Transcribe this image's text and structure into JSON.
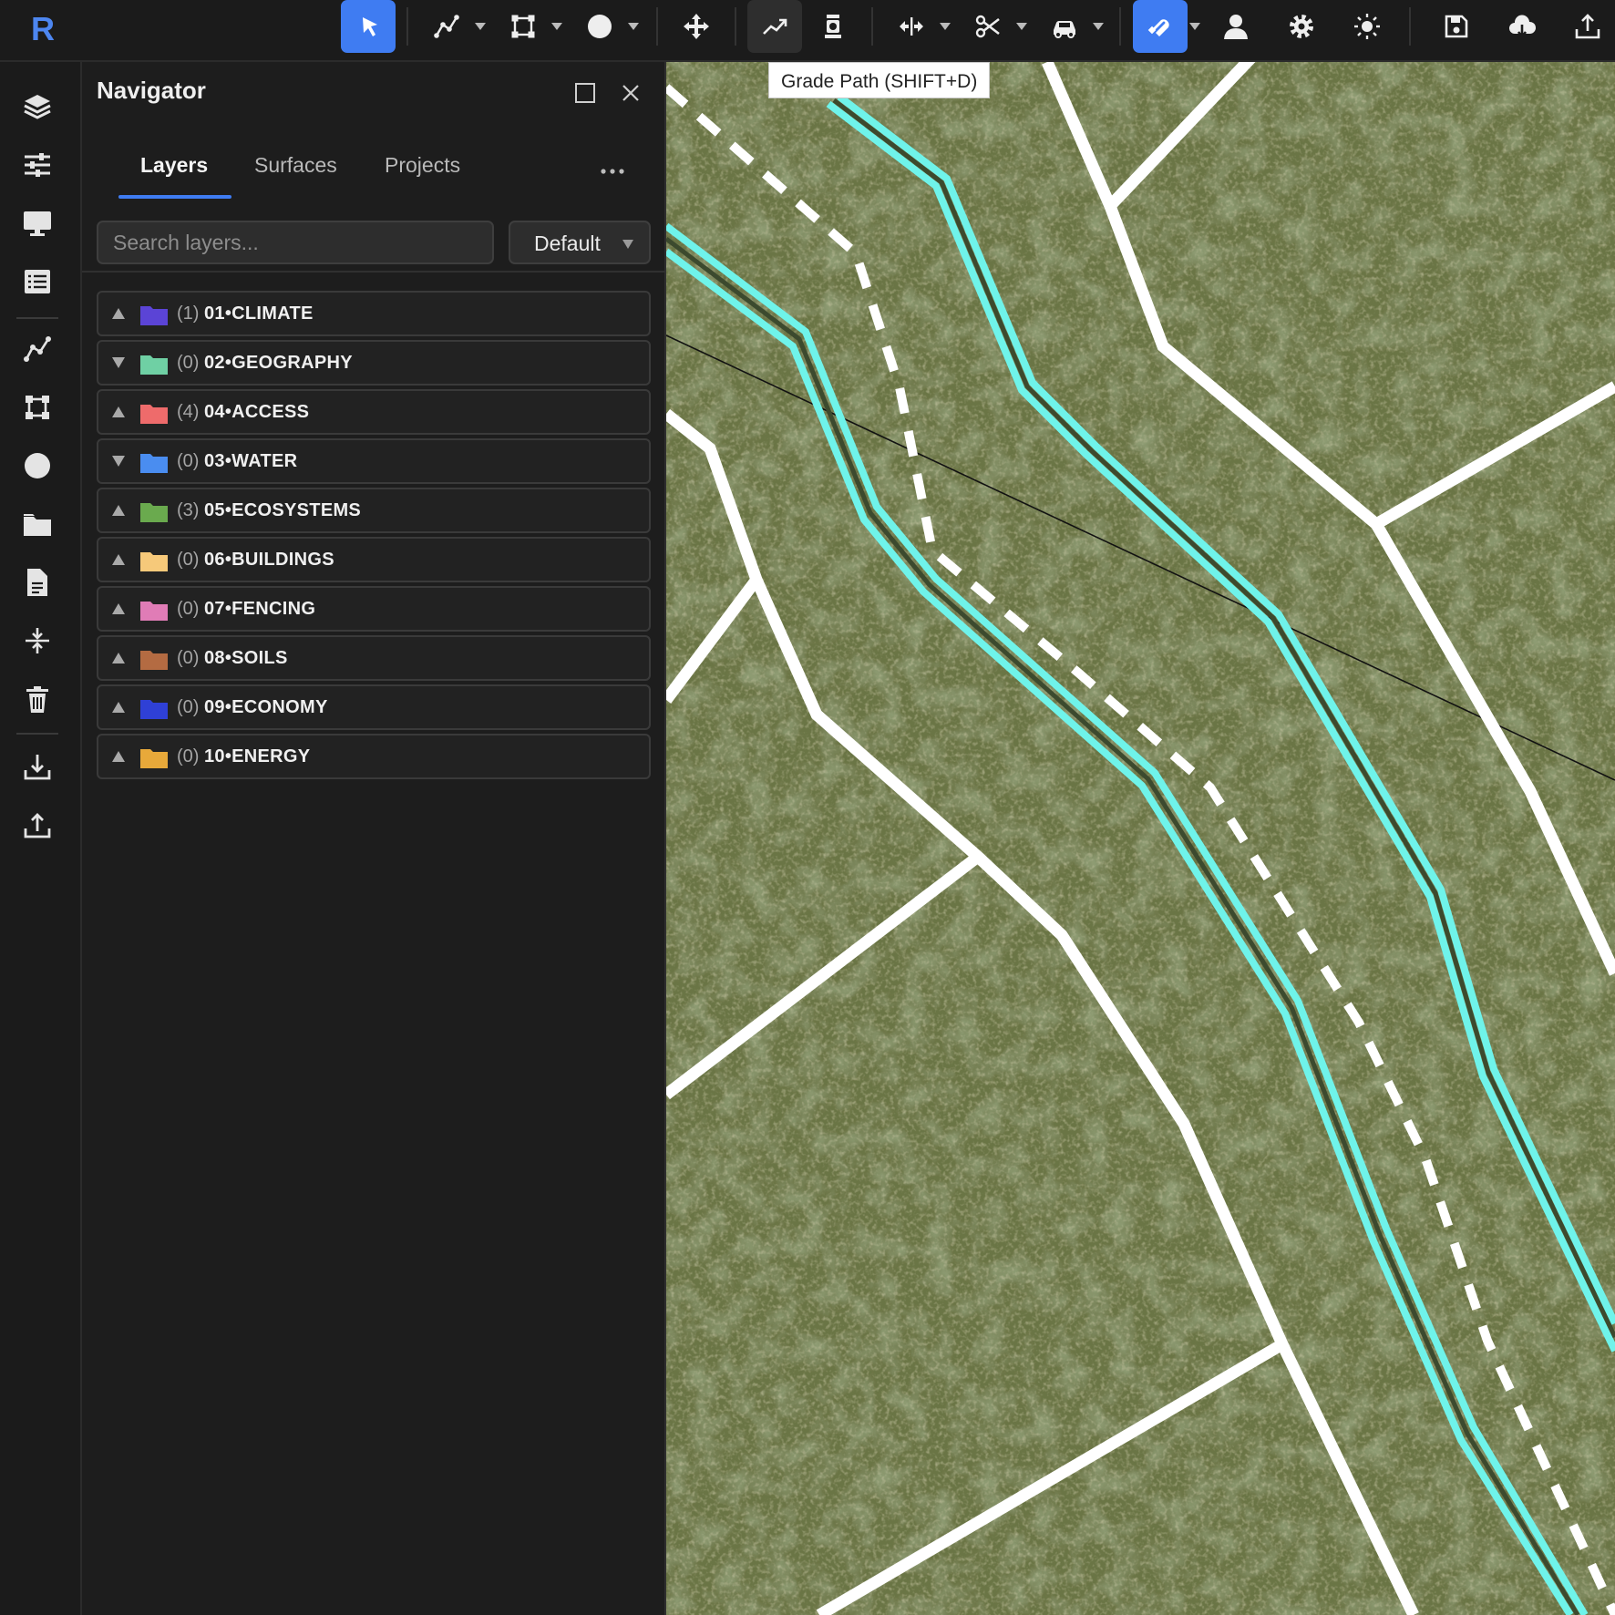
{
  "app": {
    "logo_letter": "R",
    "accent": "#3f7cf2"
  },
  "toolbar": {
    "tools": [
      {
        "name": "select-tool",
        "icon": "cursor-arrow-icon",
        "active": true
      },
      {
        "name": "polyline-tool",
        "icon": "polyline-icon",
        "dropdown": true
      },
      {
        "name": "polygon-tool",
        "icon": "polygon-icon",
        "dropdown": true
      },
      {
        "name": "point-tool",
        "icon": "circle-point-icon",
        "dropdown": true
      },
      {
        "name": "move-tool",
        "icon": "move-arrows-icon"
      },
      {
        "name": "grade-path-tool",
        "icon": "trending-up-icon",
        "hovered": true
      },
      {
        "name": "survey-tool",
        "icon": "theodolite-icon"
      },
      {
        "name": "split-tool",
        "icon": "split-arrows-icon",
        "dropdown": true
      },
      {
        "name": "cut-tool",
        "icon": "scissors-icon",
        "dropdown": true
      },
      {
        "name": "vehicle-tool",
        "icon": "car-icon",
        "dropdown": true
      },
      {
        "name": "snap-tool",
        "icon": "magnet-icon",
        "active": true,
        "dropdown": true
      },
      {
        "name": "account",
        "icon": "user-icon"
      },
      {
        "name": "settings",
        "icon": "gear-icon"
      },
      {
        "name": "theme",
        "icon": "sun-icon"
      },
      {
        "name": "save",
        "icon": "save-icon"
      },
      {
        "name": "cloud-download",
        "icon": "cloud-download-icon"
      },
      {
        "name": "export",
        "icon": "upload-icon"
      }
    ],
    "tooltip": "Grade Path (SHIFT+D)"
  },
  "rail": {
    "icons": [
      "layers-icon",
      "sliders-icon",
      "monitor-icon",
      "list-icon",
      "polyline-icon",
      "polygon-icon",
      "circle-icon",
      "folder-icon",
      "document-icon",
      "compress-icon",
      "trash-icon",
      "download-icon",
      "upload-icon"
    ]
  },
  "navigator": {
    "title": "Navigator",
    "tabs": [
      "Layers",
      "Surfaces",
      "Projects"
    ],
    "active_tab": "Layers",
    "search_placeholder": "Search layers...",
    "preset": "Default",
    "layers": [
      {
        "count": "(1)",
        "name": "01•CLIMATE",
        "color": "#5b44d6",
        "expanded": false
      },
      {
        "count": "(0)",
        "name": "02•GEOGRAPHY",
        "color": "#6fd0a4",
        "expanded": true
      },
      {
        "count": "(4)",
        "name": "04•ACCESS",
        "color": "#ee6b6b",
        "expanded": false
      },
      {
        "count": "(0)",
        "name": "03•WATER",
        "color": "#4a8df0",
        "expanded": true
      },
      {
        "count": "(3)",
        "name": "05•ECOSYSTEMS",
        "color": "#6aaa4e",
        "expanded": false
      },
      {
        "count": "(0)",
        "name": "06•BUILDINGS",
        "color": "#f6c97a",
        "expanded": false
      },
      {
        "count": "(0)",
        "name": "07•FENCING",
        "color": "#e07cb6",
        "expanded": false
      },
      {
        "count": "(0)",
        "name": "08•SOILS",
        "color": "#b46b42",
        "expanded": false
      },
      {
        "count": "(0)",
        "name": "09•ECONOMY",
        "color": "#2f40d6",
        "expanded": false
      },
      {
        "count": "(0)",
        "name": "10•ENERGY",
        "color": "#e8a93a",
        "expanded": false
      }
    ]
  }
}
